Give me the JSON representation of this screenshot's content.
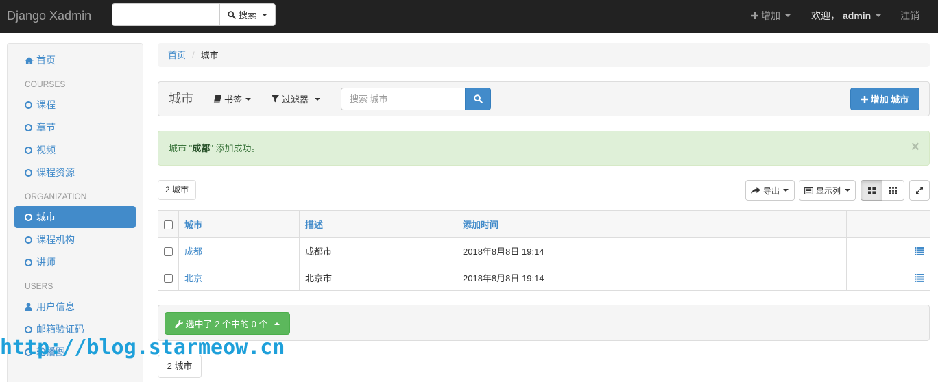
{
  "navbar": {
    "brand": "Django Xadmin",
    "search_value": "",
    "search_button": "搜索",
    "search_icon": "search-icon",
    "add_label": "增加",
    "add_icon": "plus-icon",
    "welcome_label": "欢迎，",
    "user": "admin",
    "logout": "注销"
  },
  "sidebar": {
    "home": {
      "label": "首页",
      "icon": "home-icon"
    },
    "sections": [
      {
        "header": "COURSES",
        "items": [
          {
            "label": "课程",
            "icon": "circle-o-icon"
          },
          {
            "label": "章节",
            "icon": "circle-o-icon"
          },
          {
            "label": "视频",
            "icon": "circle-o-icon"
          },
          {
            "label": "课程资源",
            "icon": "circle-o-icon"
          }
        ]
      },
      {
        "header": "ORGANIZATION",
        "items": [
          {
            "label": "城市",
            "icon": "circle-o-icon",
            "active": true
          },
          {
            "label": "课程机构",
            "icon": "circle-o-icon"
          },
          {
            "label": "讲师",
            "icon": "circle-o-icon"
          }
        ]
      },
      {
        "header": "USERS",
        "items": [
          {
            "label": "用户信息",
            "icon": "user-icon"
          },
          {
            "label": "邮箱验证码",
            "icon": "circle-o-icon"
          },
          {
            "label": "轮播图",
            "icon": "circle-o-icon"
          }
        ]
      }
    ]
  },
  "breadcrumb": {
    "home": "首页",
    "separator": "/",
    "current": "城市"
  },
  "toolbar": {
    "title": "城市",
    "bookmarks": "书签",
    "filters": "过滤器",
    "search_placeholder": "搜索 城市",
    "add_button": "增加 城市"
  },
  "alert": {
    "prefix": "城市 \"",
    "name": "成都",
    "suffix": "\" 添加成功。",
    "close": "×"
  },
  "counts": {
    "top": "2 城市",
    "bottom": "2 城市"
  },
  "view_controls": {
    "export": "导出",
    "columns": "显示列"
  },
  "table": {
    "headers": [
      "城市",
      "描述",
      "添加时间"
    ],
    "rows": [
      {
        "name": "成都",
        "description": "成都市",
        "added": "2018年8月8日 19:14"
      },
      {
        "name": "北京",
        "description": "北京市",
        "added": "2018年8月8日 19:14"
      }
    ]
  },
  "actions": {
    "selected_label": "选中了 2 个中的 0 个"
  },
  "watermark": {
    "text": "http://blog.starmeow.cn"
  },
  "theme": {
    "navbar_bg": "#222222",
    "link": "#428bca",
    "primary": "#428bca",
    "success": "#5cb85c",
    "alert_bg": "#dff0d8",
    "alert_text": "#3c763d",
    "watermark": "#1ea0da"
  }
}
